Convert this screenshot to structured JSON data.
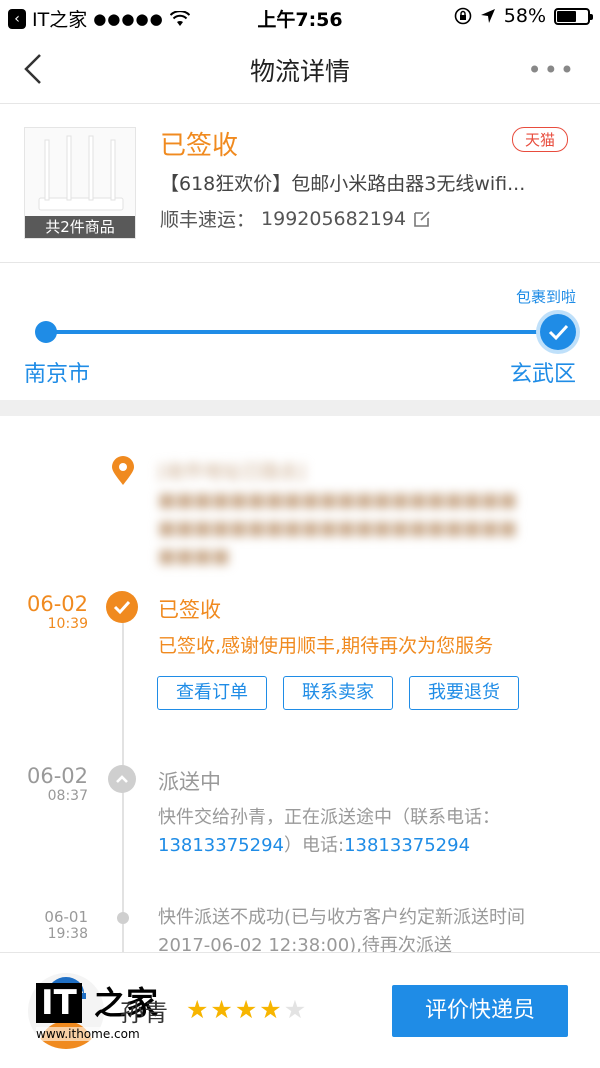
{
  "status_bar": {
    "back_app": "IT之家",
    "signal": "●●●●●",
    "time": "上午7:56",
    "battery": "58%"
  },
  "nav": {
    "title": "物流详情",
    "more": "•••"
  },
  "order": {
    "thumbnail_caption": "共2件商品",
    "status": "已签收",
    "store_badge": "天猫",
    "product_name": "【618狂欢价】包邮小米路由器3无线wifi...",
    "carrier": "顺丰速运：",
    "tracking_no": "199205682194"
  },
  "route": {
    "note": "包裹到啦",
    "from": "南京市",
    "to": "玄武区"
  },
  "address": {
    "blurred_text": "[收件地址已隐去] ■■■■■■■■■■■■■■■■■■■■ ■■■■■■■■■■■■■■■■■■■■ ■■■■"
  },
  "events": [
    {
      "date": "06-02",
      "time": "10:39",
      "title": "已签收",
      "desc": "已签收,感谢使用顺丰,期待再次为您服务"
    },
    {
      "date": "06-02",
      "time": "08:37",
      "title": "派送中",
      "desc_prefix": "快件交给孙青，正在派送途中（联系电话：",
      "phone1": "13813375294",
      "desc_mid": "）电话:",
      "phone2": "13813375294"
    },
    {
      "date": "06-01",
      "time": "19:38",
      "desc": "快件派送不成功(已与收方客户约定新派送时间 2017-06-02 12:38:00),待再次派送"
    }
  ],
  "actions": {
    "view_order": "查看订单",
    "contact_seller": "联系卖家",
    "return": "我要退货"
  },
  "courier": {
    "name": "孙青",
    "rating": 4,
    "rating_max": 5,
    "rate_button": "评价快递员"
  },
  "watermark": {
    "logo_it": "IT",
    "logo_zh": "之家",
    "url": "www.ithome.com"
  },
  "colors": {
    "primary": "#1f8ce6",
    "accent_orange": "#f08a1f",
    "tmall_red": "#e84c3d",
    "star": "#f7b500"
  }
}
